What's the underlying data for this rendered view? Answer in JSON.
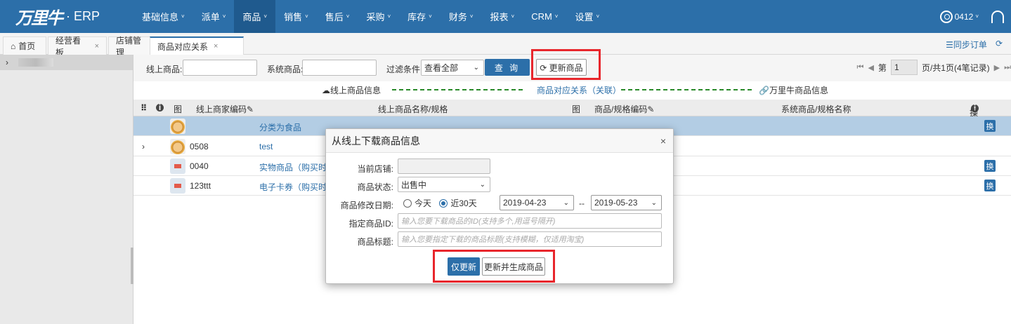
{
  "app": {
    "logo_mark": "万里牛",
    "logo_suffix": "· ERP"
  },
  "nav": {
    "items": [
      {
        "label": "基础信息",
        "caret": "˅"
      },
      {
        "label": "派单",
        "caret": "˅"
      },
      {
        "label": "商品",
        "caret": "˅"
      },
      {
        "label": "销售",
        "caret": "˅"
      },
      {
        "label": "售后",
        "caret": "˅"
      },
      {
        "label": "采购",
        "caret": "˅"
      },
      {
        "label": "库存",
        "caret": "˅"
      },
      {
        "label": "财务",
        "caret": "˅"
      },
      {
        "label": "报表",
        "caret": "˅"
      },
      {
        "label": "CRM",
        "caret": "˅"
      },
      {
        "label": "设置",
        "caret": "˅"
      }
    ],
    "active_index": 2,
    "user": "0412",
    "user_caret": "˅"
  },
  "tabs": [
    {
      "label": "首页"
    },
    {
      "label": "经营看板",
      "close": "×"
    },
    {
      "label": "店铺管理",
      "close": "×"
    },
    {
      "label": "商品对应关系",
      "close": "×"
    }
  ],
  "tabbar_right": {
    "sync_orders": "☰同步订单",
    "refresh": "⟳"
  },
  "home_icon": "⌂",
  "left_panel": {
    "expander": "›"
  },
  "filter": {
    "online_label": "线上商品:",
    "online_value": "",
    "system_label": "系统商品:",
    "system_value": "",
    "condition_label": "过滤条件:",
    "condition_value": "查看全部",
    "query_button": "查 询",
    "update_button": "⟳ 更新商品"
  },
  "pager": {
    "first": "⏮",
    "prev": "◀",
    "page_prefix": "第",
    "page": "1",
    "summary": "页/共1页(4笔记录)",
    "next": "▶",
    "last": "⏭"
  },
  "sections": {
    "online_info": "☁线上商品信息",
    "relation": "商品对应关系（关联）",
    "wanliniu_info": "🔗万里牛商品信息"
  },
  "table": {
    "headers": {
      "expand": "⠿",
      "info": "i",
      "img": "图",
      "online_code": "线上商家编码✎",
      "online_name": "线上商品名称/规格",
      "img2": "图",
      "sku_code": "商品/规格编码✎",
      "system_name": "系统商品/规格名称",
      "action": "操作"
    },
    "rows": [
      {
        "code": "",
        "name": "分类为食品",
        "expand": "",
        "swap": "换"
      },
      {
        "code": "0508",
        "name": "test",
        "expand": "›",
        "swap": ""
      },
      {
        "code": "0040",
        "name": "实物商品（购买时",
        "expand": "",
        "swap": "换"
      },
      {
        "code": "123ttt",
        "name": "电子卡券（购买时",
        "expand": "",
        "swap": "换"
      }
    ]
  },
  "modal": {
    "title": "从线上下载商品信息",
    "close": "×",
    "store_label": "当前店铺:",
    "store_value": "",
    "status_label": "商品状态:",
    "status_value": "出售中",
    "date_label": "商品修改日期:",
    "radio_today": "今天",
    "radio_30": "近30天",
    "date_from": "2019-04-23",
    "date_sep": "--",
    "date_to": "2019-05-23",
    "id_label": "指定商品ID:",
    "id_placeholder": "输入您要下载商品的ID(支持多个,用逗号隔开)",
    "title_label": "商品标题:",
    "title_placeholder": "输入您要指定下载的商品标题(支持模糊，仅适用淘宝)",
    "btn_update_only": "仅更新",
    "btn_update_generate": "更新并生成商品"
  },
  "colors": {
    "nav_bg": "#2c6fa9",
    "highlight_red": "#e8262c",
    "row_selected": "#b3cde4"
  }
}
